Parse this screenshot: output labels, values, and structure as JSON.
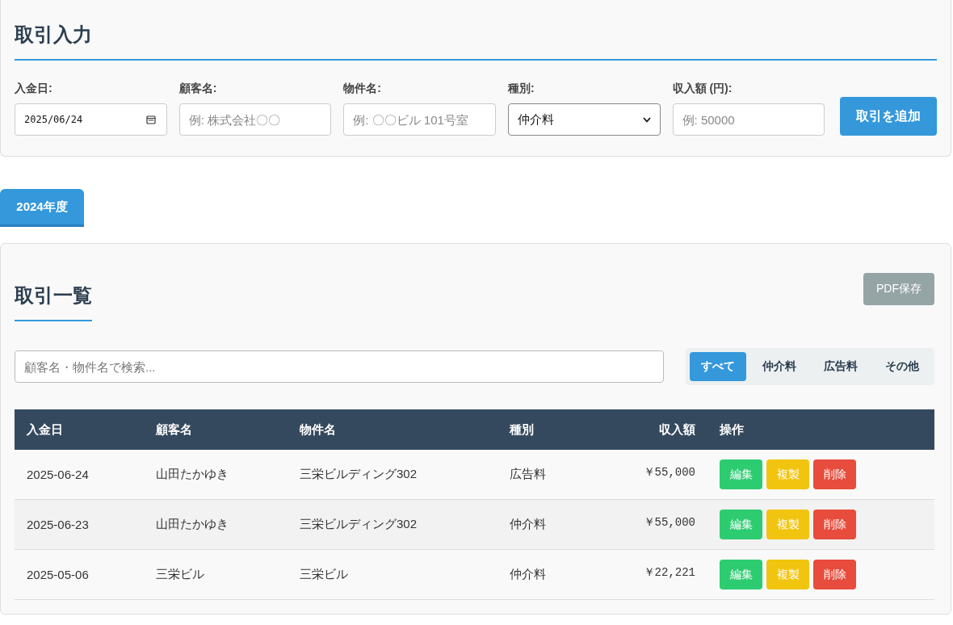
{
  "entry_form": {
    "title": "取引入力",
    "fields": [
      {
        "kind": "date",
        "label": "入金日:",
        "value": "2025/06/24"
      },
      {
        "kind": "text",
        "label": "顧客名:",
        "placeholder": "例: 株式会社〇〇"
      },
      {
        "kind": "text",
        "label": "物件名:",
        "placeholder": "例: 〇〇ビル 101号室"
      },
      {
        "kind": "select",
        "label": "種別:",
        "value": "仲介料"
      },
      {
        "kind": "text",
        "label": "収入額 (円):",
        "placeholder": "例: 50000"
      }
    ],
    "submit_button": "取引を追加"
  },
  "year_tabs": [
    {
      "label": "2024年度",
      "selected": true
    }
  ],
  "list": {
    "title": "取引一覧",
    "pdf_button": "PDF保存",
    "search": {
      "placeholder": "顧客名・物件名で検索..."
    },
    "filters": [
      {
        "label": "すべて",
        "selected": true
      },
      {
        "label": "仲介料",
        "selected": false
      },
      {
        "label": "広告料",
        "selected": false
      },
      {
        "label": "その他",
        "selected": false
      }
    ],
    "table": {
      "columns": [
        "入金日",
        "顧客名",
        "物件名",
        "種別",
        "収入額",
        "操作"
      ],
      "rows": [
        {
          "date": "2025-06-24",
          "customer": "山田たかゆき",
          "property": "三栄ビルディング302",
          "type": "広告料",
          "amount": "￥55,000",
          "actions": [
            {
              "kind": "edit",
              "label": "編集"
            },
            {
              "kind": "copy",
              "label": "複製"
            },
            {
              "kind": "delete",
              "label": "削除"
            }
          ]
        },
        {
          "date": "2025-06-23",
          "customer": "山田たかゆき",
          "property": "三栄ビルディング302",
          "type": "仲介料",
          "amount": "￥55,000",
          "actions": [
            {
              "kind": "edit",
              "label": "編集"
            },
            {
              "kind": "copy",
              "label": "複製"
            },
            {
              "kind": "delete",
              "label": "削除"
            }
          ]
        },
        {
          "date": "2025-05-06",
          "customer": "三栄ビル",
          "property": "三栄ビル",
          "type": "仲介料",
          "amount": "￥22,221",
          "actions": [
            {
              "kind": "edit",
              "label": "編集"
            },
            {
              "kind": "copy",
              "label": "複製"
            },
            {
              "kind": "delete",
              "label": "削除"
            }
          ]
        }
      ]
    }
  }
}
